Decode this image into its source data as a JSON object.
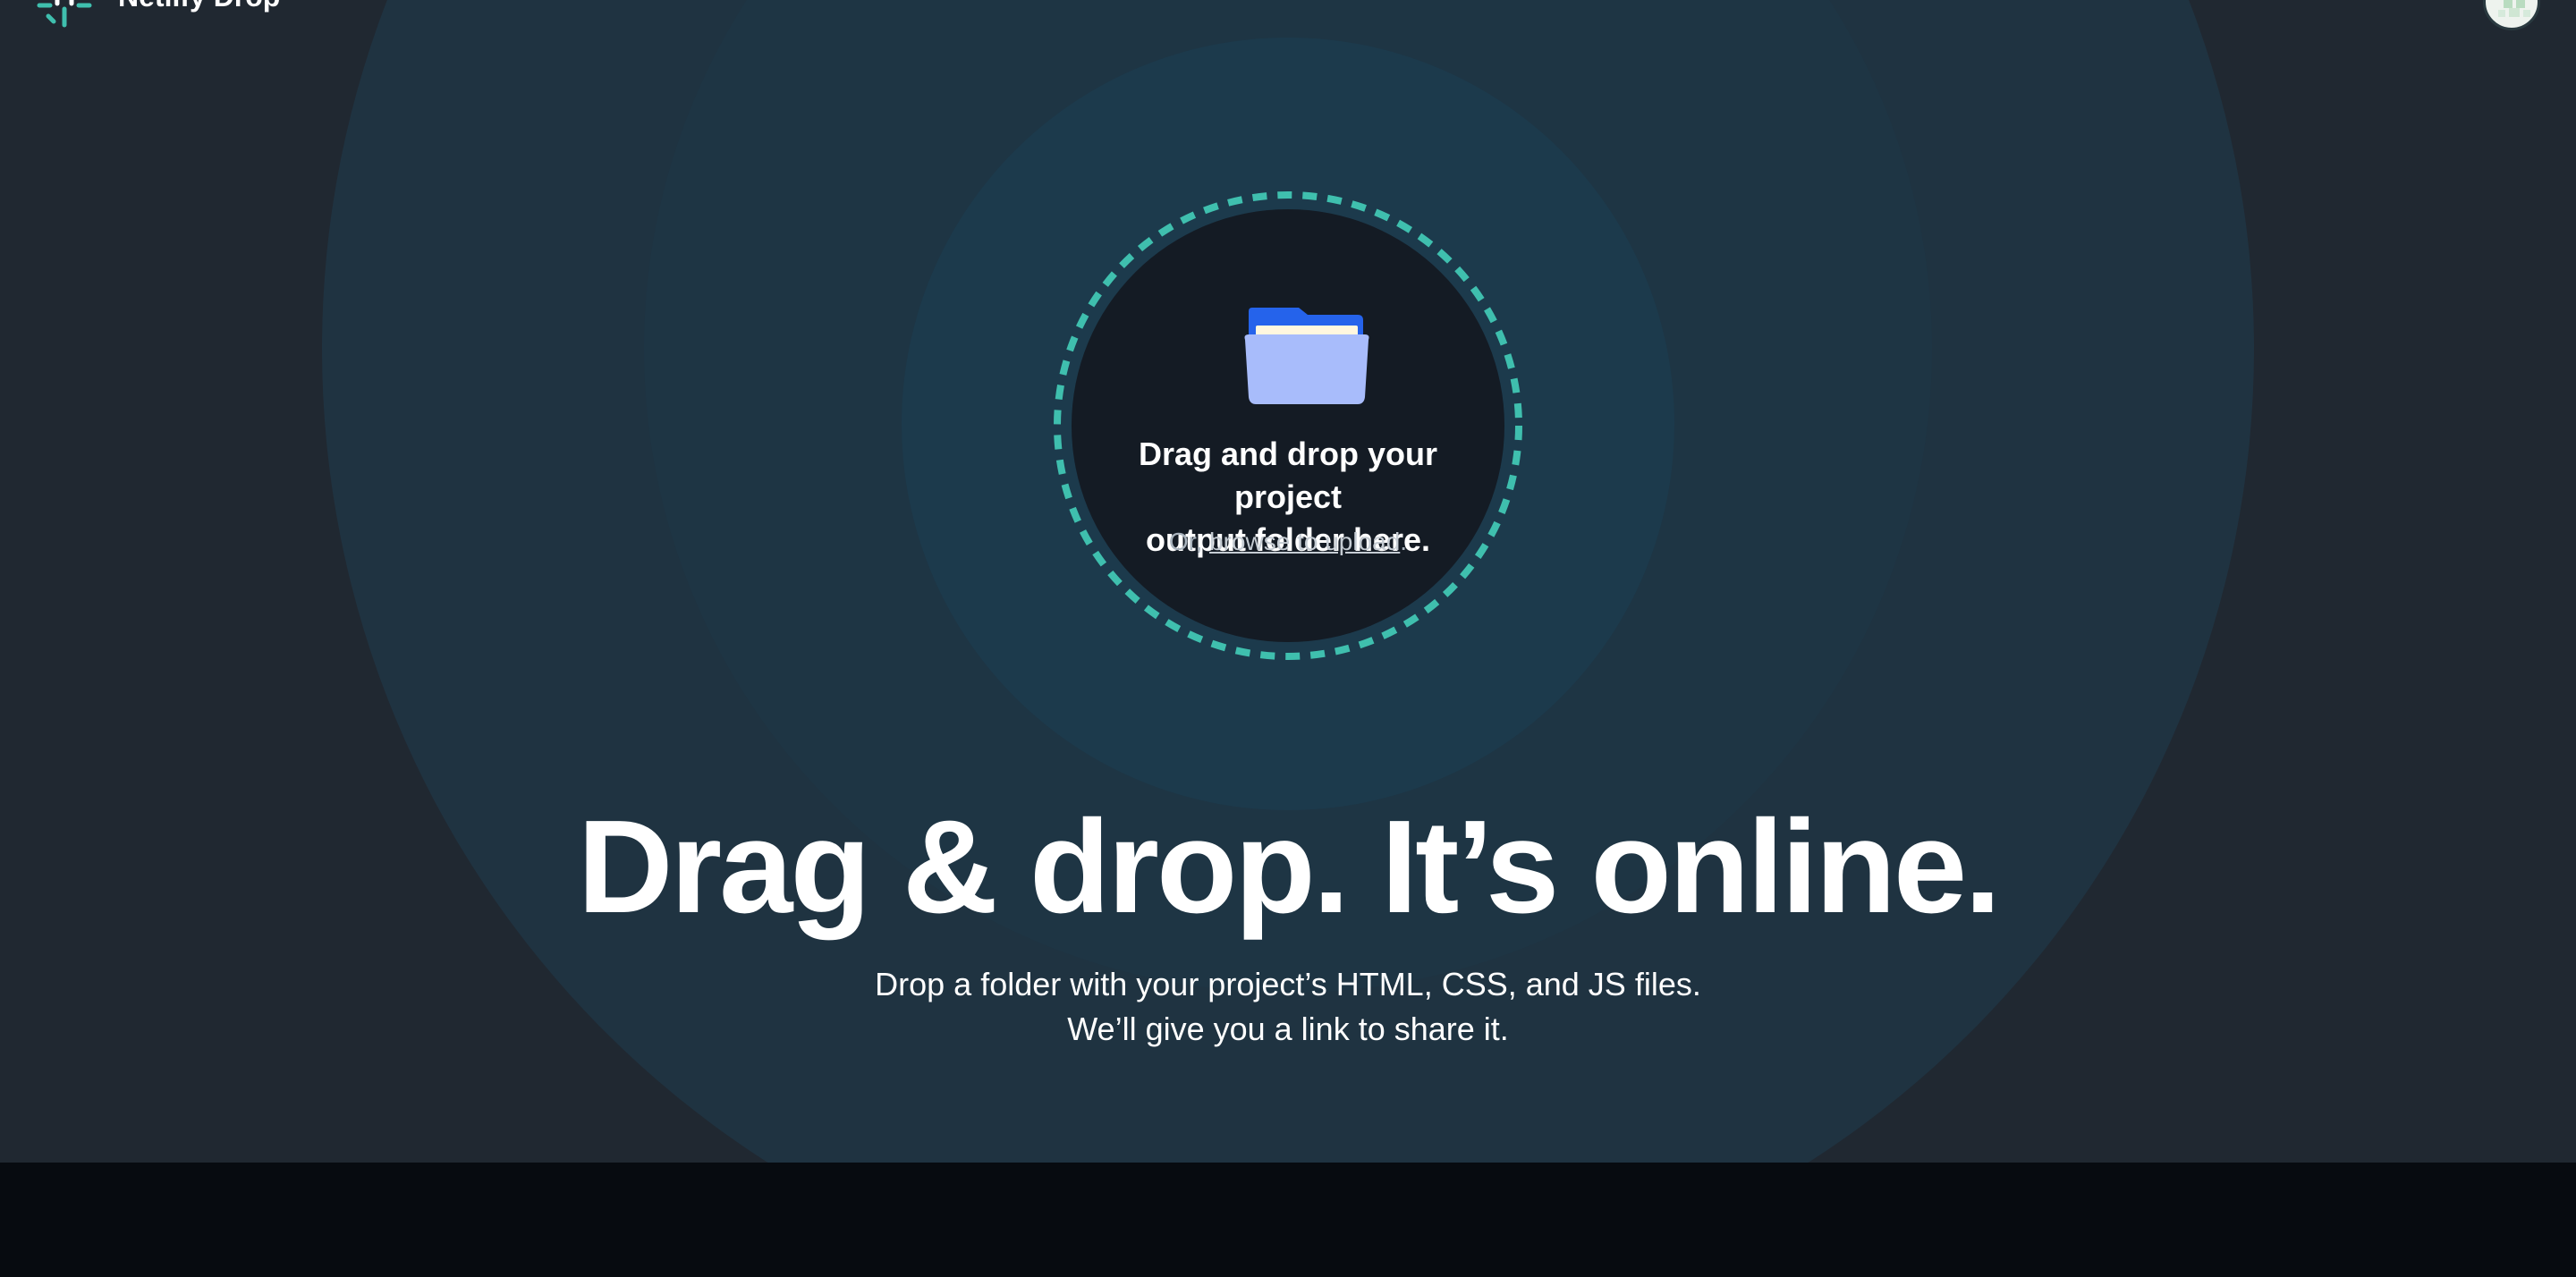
{
  "header": {
    "app_name": "Netlify Drop",
    "logo_icon": "netlify-logo-icon",
    "avatar_icon": "user-avatar-icon"
  },
  "dropzone": {
    "icon": "folder-icon",
    "title_line1": "Drag and drop your project",
    "title_line2": "output folder here.",
    "sub_prefix": "Or, ",
    "browse_link": "browse to upload",
    "sub_suffix": "."
  },
  "hero": {
    "title": "Drag & drop. It’s online.",
    "subtitle_line1": "Drop a folder with your project’s HTML, CSS, and JS files.",
    "subtitle_line2": "We’ll give you a link to share it."
  },
  "colors": {
    "accent": "#3fbfae",
    "background": "#202831",
    "dropzone_fill": "#141b24",
    "footer": "#070b10"
  }
}
